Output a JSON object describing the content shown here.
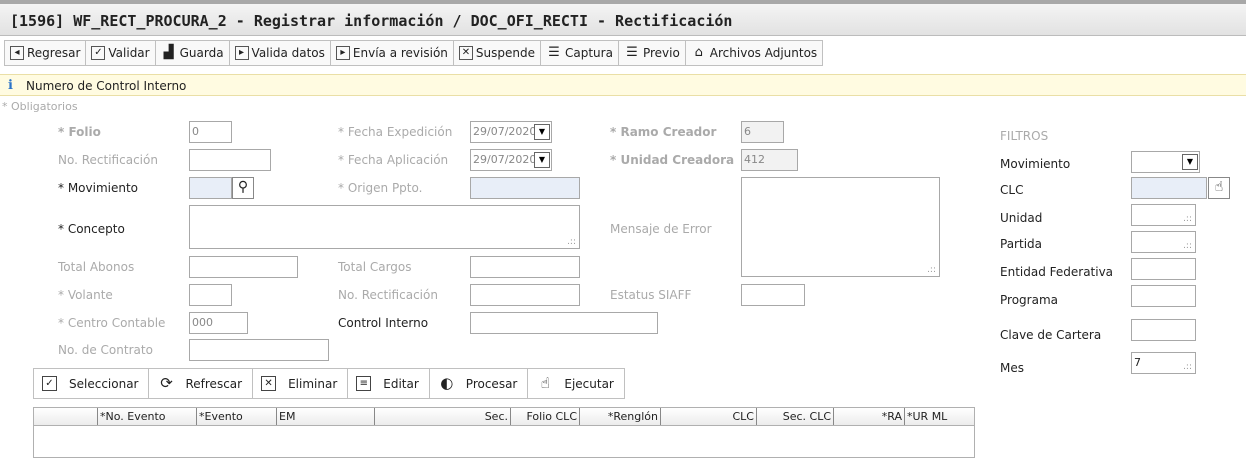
{
  "title": "[1596]  WF_RECT_PROCURA_2 - Registrar información / DOC_OFI_RECTI - Rectificación",
  "toolbar": [
    {
      "label": "Regresar",
      "icon": "back-icon",
      "glyph": "◂"
    },
    {
      "label": "Validar",
      "icon": "check-icon",
      "glyph": "✓"
    },
    {
      "label": "Guarda",
      "icon": "save-icon",
      "glyph": "▟"
    },
    {
      "label": "Valida datos",
      "icon": "play-icon",
      "glyph": "▸"
    },
    {
      "label": "Envía a revisión",
      "icon": "send-icon",
      "glyph": "▸"
    },
    {
      "label": "Suspende",
      "icon": "close-icon",
      "glyph": "✕"
    },
    {
      "label": "Captura",
      "icon": "capture-icon",
      "glyph": "☰"
    },
    {
      "label": "Previo",
      "icon": "preview-icon",
      "glyph": "☰"
    },
    {
      "label": "Archivos Adjuntos",
      "icon": "folder-icon",
      "glyph": "⌂"
    }
  ],
  "info_bar": {
    "text": "Numero de Control Interno",
    "icon": "info-icon"
  },
  "form": {
    "required_note": "* Obligatorios",
    "folio": {
      "label": "* Folio",
      "value": "0"
    },
    "no_rectificacion": {
      "label": "No. Rectificación",
      "value": ""
    },
    "movimiento": {
      "label": "* Movimiento",
      "value": ""
    },
    "concepto": {
      "label": "* Concepto",
      "value": ""
    },
    "total_abonos": {
      "label": "Total Abonos",
      "value": ""
    },
    "volante": {
      "label": "* Volante",
      "value": ""
    },
    "centro_contable": {
      "label": "* Centro Contable",
      "value": "000"
    },
    "no_contrato": {
      "label": "No. de Contrato",
      "value": ""
    },
    "fecha_expedicion": {
      "label": "* Fecha Expedición",
      "value": "29/07/2020"
    },
    "fecha_aplicacion": {
      "label": "* Fecha Aplicación",
      "value": "29/07/2020"
    },
    "origen_ppto": {
      "label": "* Origen Ppto.",
      "value": ""
    },
    "total_cargos": {
      "label": "Total Cargos",
      "value": ""
    },
    "no_rectificacion2": {
      "label": "No. Rectificación",
      "value": ""
    },
    "control_interno": {
      "label": "Control Interno",
      "value": ""
    },
    "ramo_creador": {
      "label": "* Ramo Creador",
      "value": "6"
    },
    "unidad_creadora": {
      "label": "* Unidad Creadora",
      "value": "412"
    },
    "mensaje_error": {
      "label": "Mensaje de Error",
      "value": ""
    },
    "estatus_siaff": {
      "label": "Estatus SIAFF",
      "value": ""
    }
  },
  "filters": {
    "title": "FILTROS",
    "movimiento": {
      "label": "Movimiento",
      "value": ""
    },
    "clc": {
      "label": "CLC",
      "value": ""
    },
    "unidad": {
      "label": "Unidad",
      "value": ""
    },
    "partida": {
      "label": "Partida",
      "value": ""
    },
    "entidad_federativa": {
      "label": "Entidad Federativa",
      "value": ""
    },
    "programa": {
      "label": "Programa",
      "value": ""
    },
    "clave_cartera": {
      "label": "Clave de Cartera",
      "value": ""
    },
    "mes": {
      "label": "Mes",
      "value": "7"
    }
  },
  "grid_toolbar": [
    {
      "label": "Seleccionar",
      "icon": "checkbox-icon",
      "glyph": "✓"
    },
    {
      "label": "Refrescar",
      "icon": "refresh-icon",
      "glyph": "⟳"
    },
    {
      "label": "Eliminar",
      "icon": "delete-icon",
      "glyph": "✕"
    },
    {
      "label": "Editar",
      "icon": "edit-icon",
      "glyph": "≡"
    },
    {
      "label": "Procesar",
      "icon": "process-icon",
      "glyph": "◐"
    },
    {
      "label": "Ejecutar",
      "icon": "execute-icon",
      "glyph": "☝"
    }
  ],
  "grid": {
    "columns": [
      "",
      "*No. Evento",
      "*Evento",
      "EM",
      "Sec.",
      "Folio CLC",
      "*Renglón",
      "CLC",
      "Sec. CLC",
      "*RA",
      "*UR ML"
    ]
  }
}
